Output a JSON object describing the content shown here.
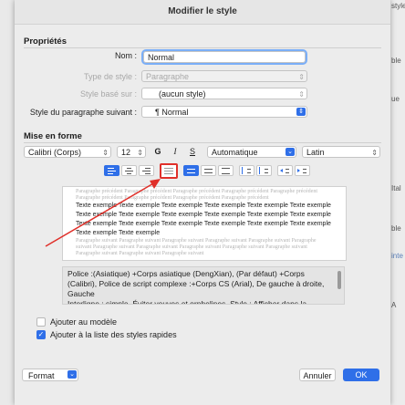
{
  "dialog_title": "Modifier le style",
  "properties": {
    "section_title": "Propriétés",
    "name_label": "Nom :",
    "name_value": "Normal",
    "style_type_label": "Type de style :",
    "style_type_value": "Paragraphe",
    "based_on_label": "Style basé sur :",
    "based_on_value": "(aucun style)",
    "following_label": "Style du paragraphe suivant :",
    "following_value": "¶ Normal"
  },
  "formatting": {
    "section_title": "Mise en forme",
    "font": "Calibri (Corps)",
    "size": "12",
    "bold": "G",
    "italic": "I",
    "underline": "S",
    "color": "Automatique",
    "script": "Latin"
  },
  "preview": {
    "previous_text": "Paragraphe précédent Paragraphe précédent Paragraphe précédent Paragraphe précédent Paragraphe précédent Paragraphe précédent Paragraphe précédent Paragraphe précédent Paragraphe précédent",
    "sample_text": "Texte exemple Texte exemple Texte exemple Texte exemple Texte exemple Texte exemple Texte exemple Texte exemple Texte exemple Texte exemple Texte exemple Texte exemple Texte exemple Texte exemple Texte exemple Texte exemple Texte exemple Texte exemple Texte exemple Texte exemple",
    "next_text": "Paragraphe suivant Paragraphe suivant Paragraphe suivant Paragraphe suivant Paragraphe suivant Paragraphe suivant Paragraphe suivant Paragraphe suivant Paragraphe suivant Paragraphe suivant Paragraphe suivant Paragraphe suivant Paragraphe suivant Paragraphe suivant"
  },
  "description": "Police :(Asiatique) +Corps asiatique (DengXian), (Par défaut) +Corps (Calibri), Police de script complexe :+Corps CS (Arial), De gauche à droite, Gauche\n   Interligne : simple, Éviter veuves et orphelines, Style : Afficher dans la",
  "options": {
    "add_to_template": "Ajouter au modèle",
    "add_to_quick_styles": "Ajouter à la liste des styles rapides",
    "add_to_template_checked": false,
    "add_to_quick_styles_checked": true
  },
  "footer": {
    "format_label": "Format",
    "cancel_label": "Annuler",
    "ok_label": "OK"
  },
  "background": {
    "right_texts": [
      "styles",
      "ble",
      "ue",
      "Ital",
      "ble",
      "inte",
      "A"
    ]
  },
  "colors": {
    "accent": "#2f6fe8",
    "annotation": "#e0302a"
  }
}
